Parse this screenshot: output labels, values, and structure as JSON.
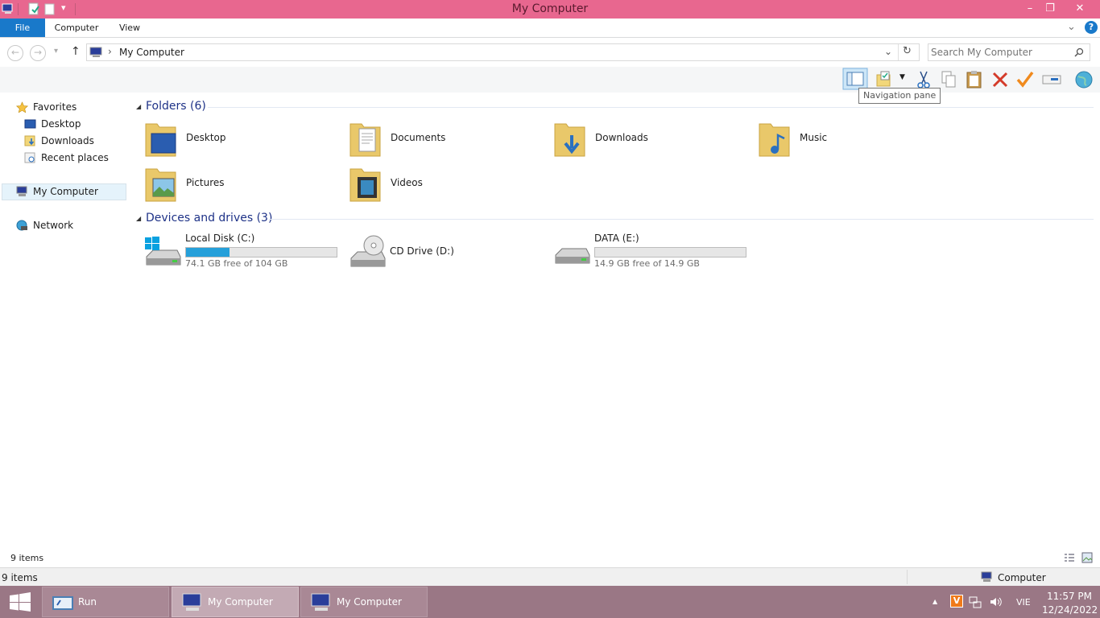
{
  "window": {
    "title": "My Computer",
    "controls": {
      "minimize": "–",
      "restore": "❐",
      "close": "✕"
    }
  },
  "ribbon": {
    "tabs": [
      "File",
      "Computer",
      "View"
    ],
    "expand": "⌄",
    "help": "?"
  },
  "address": {
    "back": "←",
    "forward": "→",
    "recent": "▾",
    "up": "↑",
    "separator": "›",
    "path": "My Computer",
    "dropdown": "⌄",
    "refresh": "↻",
    "search_placeholder": "Search My Computer"
  },
  "tooltip": "Navigation pane",
  "navpane": {
    "favorites": "Favorites",
    "favorites_items": [
      "Desktop",
      "Downloads",
      "Recent places"
    ],
    "computer": "My Computer",
    "network": "Network"
  },
  "content": {
    "folders_header": "Folders (6)",
    "folders": [
      "Desktop",
      "Documents",
      "Downloads",
      "Music",
      "Pictures",
      "Videos"
    ],
    "drives_header": "Devices and drives (3)",
    "drives": [
      {
        "name": "Local Disk (C:)",
        "free": "74.1 GB free of 104 GB",
        "used_fraction": 0.288
      },
      {
        "name": "CD Drive (D:)"
      },
      {
        "name": "DATA (E:)",
        "free": "14.9 GB free of 14.9 GB",
        "used_fraction": 0.0
      }
    ]
  },
  "status": {
    "items": "9 items",
    "bottom_items": "9 items",
    "location": "Computer"
  },
  "taskbar": {
    "buttons": [
      "Run",
      "My Computer",
      "My Computer"
    ],
    "tray_arrow": "▲",
    "lang": "VIE",
    "time": "11:57 PM",
    "date": "12/24/2022"
  },
  "colors": {
    "titlebar": "#e8678f",
    "file_tab": "#1979ca",
    "group_header": "#1e3287",
    "drive_fill": "#26a0da",
    "taskbar": "#9a7785"
  }
}
